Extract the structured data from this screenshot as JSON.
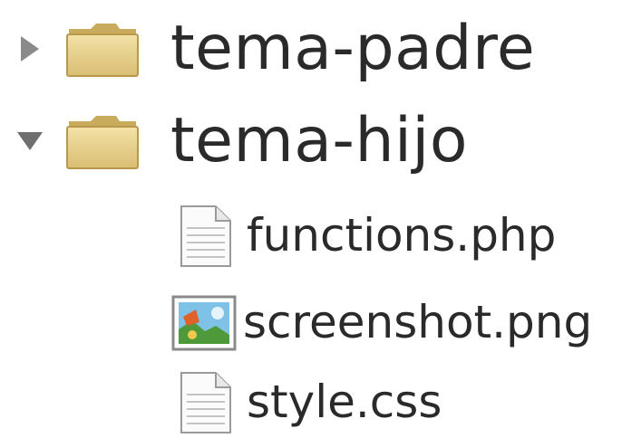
{
  "tree": {
    "items": [
      {
        "label": "tema-padre",
        "expanded": false,
        "icon": "folder-icon",
        "arrow": "triangle-right-icon"
      },
      {
        "label": "tema-hijo",
        "expanded": true,
        "icon": "folder-icon",
        "arrow": "triangle-down-icon",
        "children": [
          {
            "label": "functions.php",
            "icon": "text-file-icon"
          },
          {
            "label": "screenshot.png",
            "icon": "image-file-icon"
          },
          {
            "label": "style.css",
            "icon": "text-file-icon"
          }
        ]
      }
    ]
  },
  "colors": {
    "folder": "#e6cf8c",
    "folder_dark": "#c9ab5e",
    "arrow": "#888888",
    "text": "#2a2a2a"
  }
}
